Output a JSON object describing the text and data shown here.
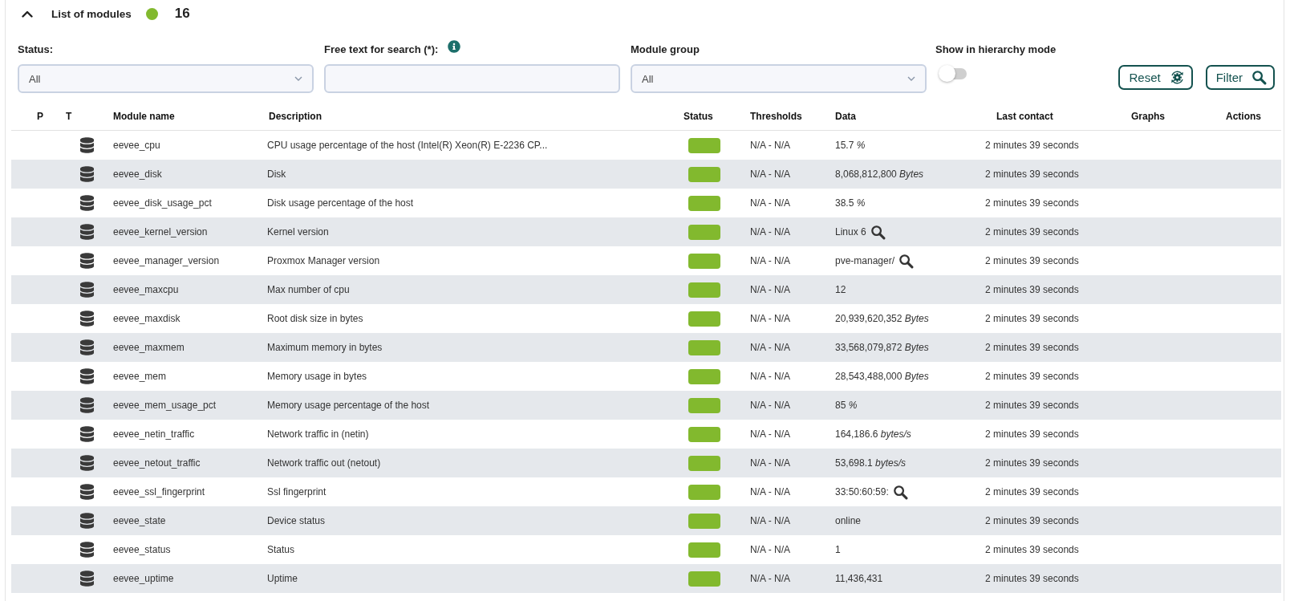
{
  "panel": {
    "title": "List of modules",
    "expanded": true,
    "color": "#82b92e",
    "count": "16"
  },
  "filters": {
    "status": {
      "label": "Status:",
      "value": "All"
    },
    "search": {
      "label": "Free text for search (*):"
    },
    "module_group": {
      "label": "Module group",
      "value": "All"
    },
    "hierarchy_mode": {
      "label": "Show in hierarchy mode",
      "on": false
    }
  },
  "buttons": [
    {
      "label": "Reset",
      "kind": "reset"
    },
    {
      "label": "Filter",
      "kind": "filter"
    }
  ],
  "table": {
    "columns": [
      "P",
      "T",
      "Module name",
      "Description",
      "Status",
      "Thresholds",
      "Data",
      "Last contact",
      "Graphs",
      "Actions"
    ],
    "rows": [
      {
        "name": "eevee_cpu",
        "description": "CPU usage percentage of the host (Intel(R) Xeon(R) E-2236 CP...",
        "color": "#82b92e",
        "thresholds": "N/A - N/A",
        "data": "15.7 *%*",
        "more": false,
        "last_contact": "2 minutes 39 seconds"
      },
      {
        "name": "eevee_disk",
        "description": "Disk",
        "color": "#82b92e",
        "thresholds": "N/A - N/A",
        "data": "8,068,812,800 *Bytes*",
        "more": false,
        "last_contact": "2 minutes 39 seconds"
      },
      {
        "name": "eevee_disk_usage_pct",
        "description": "Disk usage percentage of the host",
        "color": "#82b92e",
        "thresholds": "N/A - N/A",
        "data": "38.5 *%*",
        "more": false,
        "last_contact": "2 minutes 39 seconds"
      },
      {
        "name": "eevee_kernel_version",
        "description": "Kernel version",
        "color": "#82b92e",
        "thresholds": "N/A - N/A",
        "data": "Linux 6",
        "more": true,
        "last_contact": "2 minutes 39 seconds"
      },
      {
        "name": "eevee_manager_version",
        "description": "Proxmox Manager version",
        "color": "#82b92e",
        "thresholds": "N/A - N/A",
        "data": "pve-manager/",
        "more": true,
        "last_contact": "2 minutes 39 seconds"
      },
      {
        "name": "eevee_maxcpu",
        "description": "Max number of cpu",
        "color": "#82b92e",
        "thresholds": "N/A - N/A",
        "data": "12",
        "more": false,
        "last_contact": "2 minutes 39 seconds"
      },
      {
        "name": "eevee_maxdisk",
        "description": "Root disk size in bytes",
        "color": "#82b92e",
        "thresholds": "N/A - N/A",
        "data": "20,939,620,352 *Bytes*",
        "more": false,
        "last_contact": "2 minutes 39 seconds"
      },
      {
        "name": "eevee_maxmem",
        "description": "Maximum memory in bytes",
        "color": "#82b92e",
        "thresholds": "N/A - N/A",
        "data": "33,568,079,872 *Bytes*",
        "more": false,
        "last_contact": "2 minutes 39 seconds"
      },
      {
        "name": "eevee_mem",
        "description": "Memory usage in bytes",
        "color": "#82b92e",
        "thresholds": "N/A - N/A",
        "data": "28,543,488,000 *Bytes*",
        "more": false,
        "last_contact": "2 minutes 39 seconds"
      },
      {
        "name": "eevee_mem_usage_pct",
        "description": "Memory usage percentage of the host",
        "color": "#82b92e",
        "thresholds": "N/A - N/A",
        "data": "85 *%*",
        "more": false,
        "last_contact": "2 minutes 39 seconds"
      },
      {
        "name": "eevee_netin_traffic",
        "description": "Network traffic in (netin)",
        "color": "#82b92e",
        "thresholds": "N/A - N/A",
        "data": "164,186.6 *bytes/s*",
        "more": false,
        "last_contact": "2 minutes 39 seconds"
      },
      {
        "name": "eevee_netout_traffic",
        "description": "Network traffic out (netout)",
        "color": "#82b92e",
        "thresholds": "N/A - N/A",
        "data": "53,698.1 *bytes/s*",
        "more": false,
        "last_contact": "2 minutes 39 seconds"
      },
      {
        "name": "eevee_ssl_fingerprint",
        "description": "Ssl fingerprint",
        "color": "#82b92e",
        "thresholds": "N/A - N/A",
        "data": "33:50:60:59:",
        "more": true,
        "last_contact": "2 minutes 39 seconds"
      },
      {
        "name": "eevee_state",
        "description": "Device status",
        "color": "#82b92e",
        "thresholds": "N/A - N/A",
        "data": "online",
        "more": false,
        "last_contact": "2 minutes 39 seconds"
      },
      {
        "name": "eevee_status",
        "description": "Status",
        "color": "#82b92e",
        "thresholds": "N/A - N/A",
        "data": "1",
        "more": false,
        "last_contact": "2 minutes 39 seconds"
      },
      {
        "name": "eevee_uptime",
        "description": "Uptime",
        "color": "#82b92e",
        "thresholds": "N/A - N/A",
        "data": "11,436,431",
        "more": false,
        "last_contact": "2 minutes 39 seconds"
      }
    ]
  }
}
